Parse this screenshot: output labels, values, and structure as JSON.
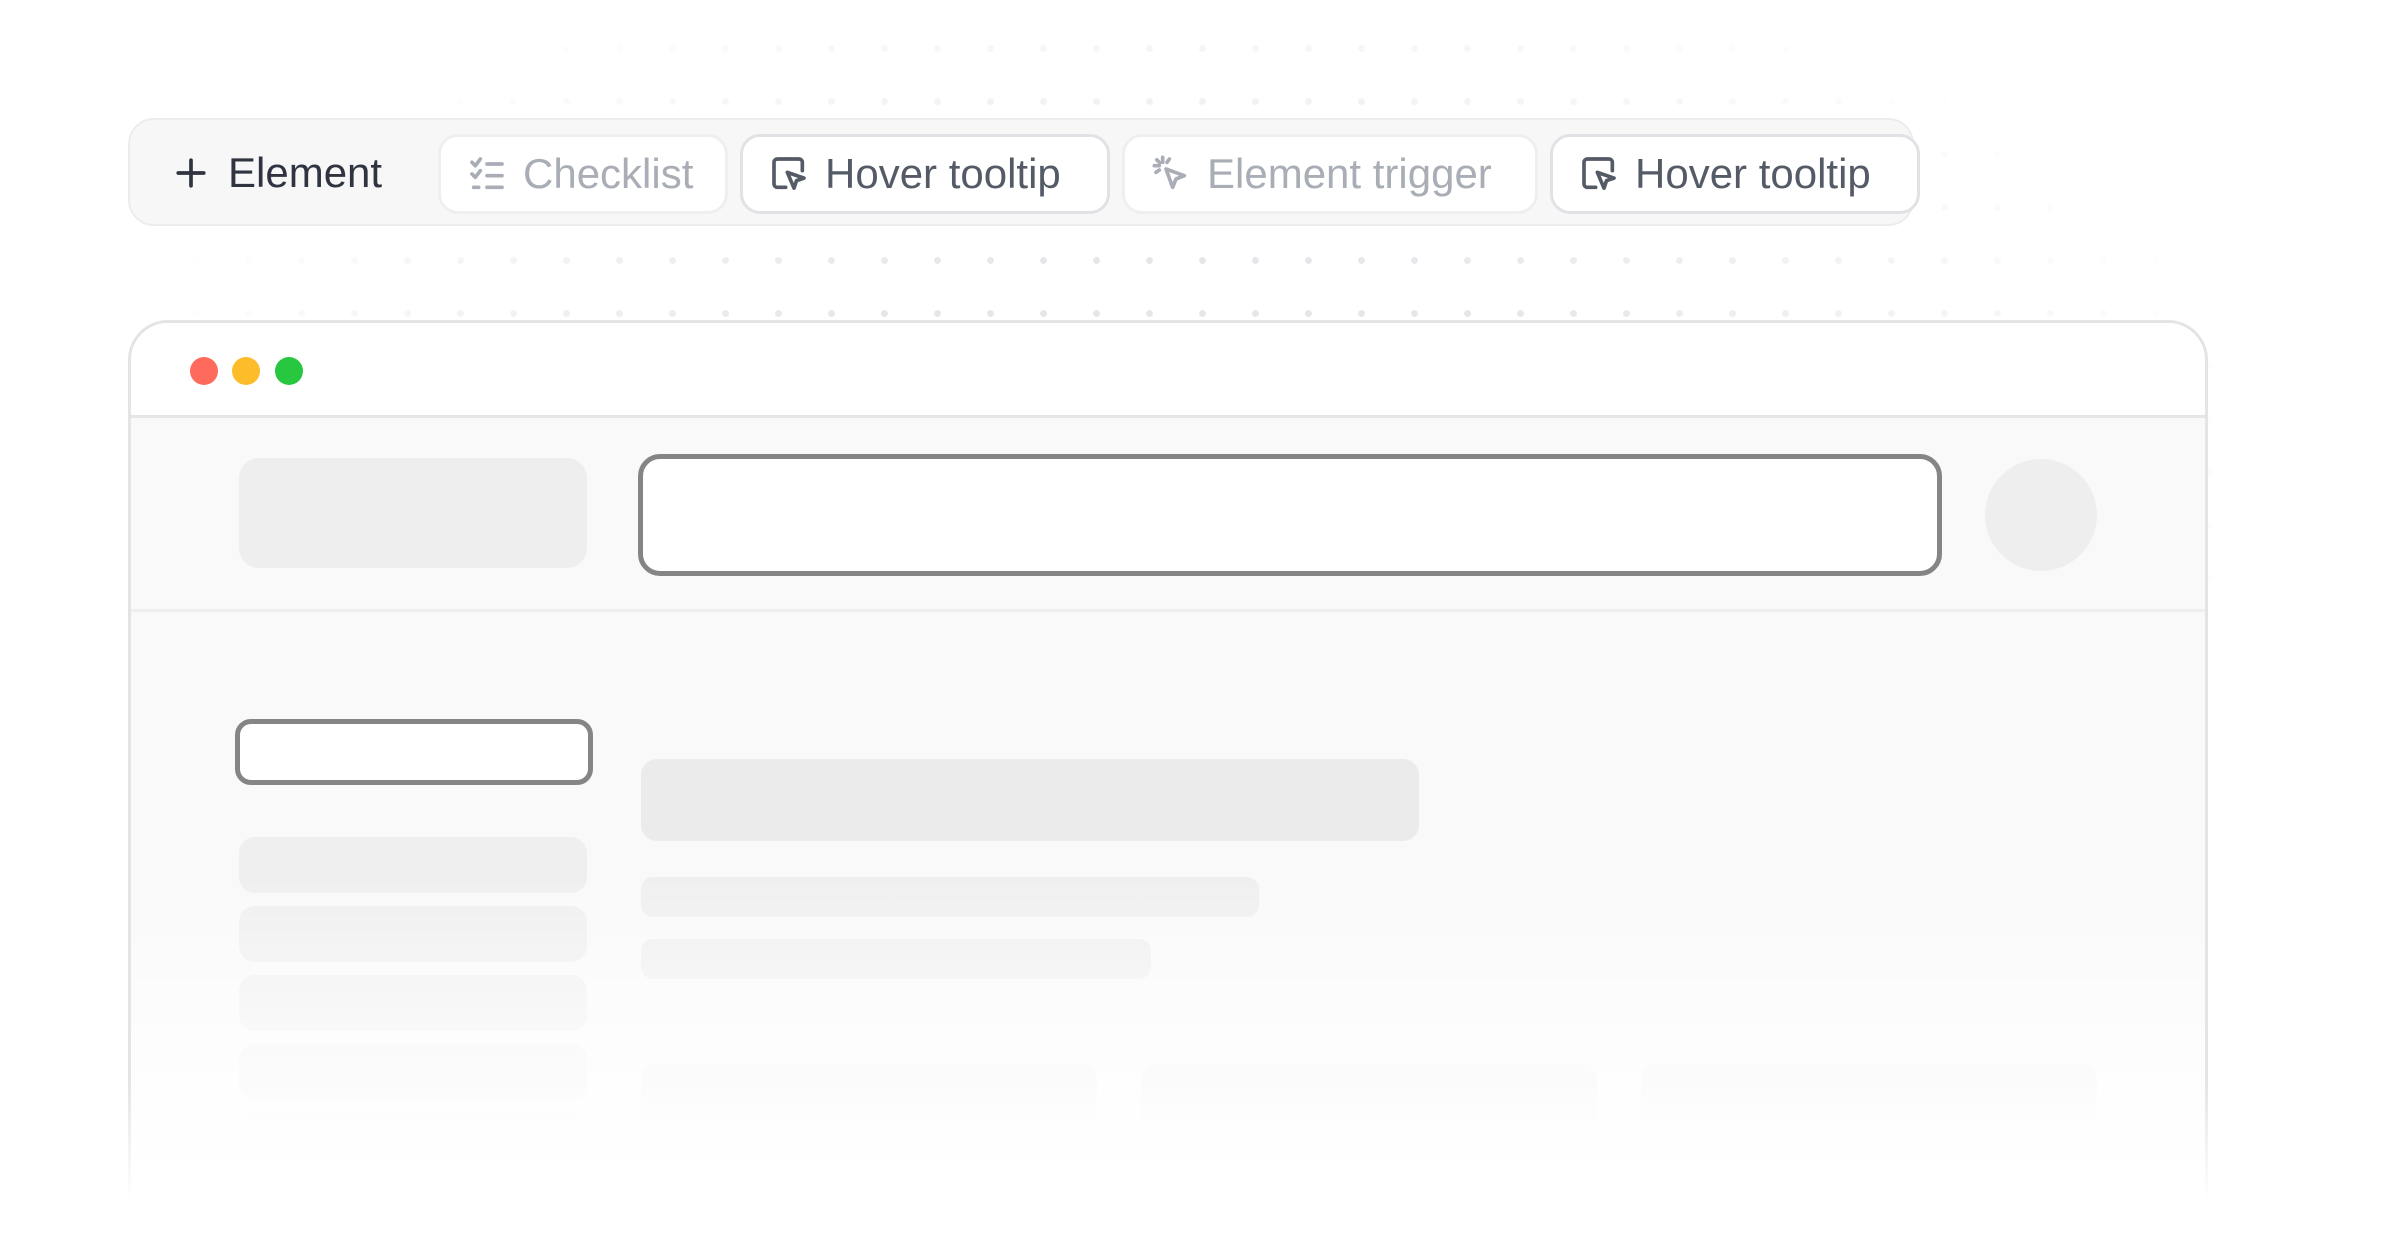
{
  "toolbar": {
    "add_label": "Element",
    "add_icon": "plus-icon",
    "chips": [
      {
        "label": "Checklist",
        "icon": "checklist-icon",
        "state": "muted"
      },
      {
        "label": "Hover tooltip",
        "icon": "cursor-click-icon",
        "state": "active"
      },
      {
        "label": "Element trigger",
        "icon": "sparkle-cursor-icon",
        "state": "muted"
      },
      {
        "label": "Hover tooltip",
        "icon": "cursor-click-icon",
        "state": "active"
      }
    ]
  },
  "window": {
    "traffic_lights": {
      "close": "#fe6a5b",
      "minimize": "#fdbd2b",
      "zoom": "#27c73f"
    },
    "highlight_color": "#858585",
    "skeleton_color": "#efefef"
  }
}
